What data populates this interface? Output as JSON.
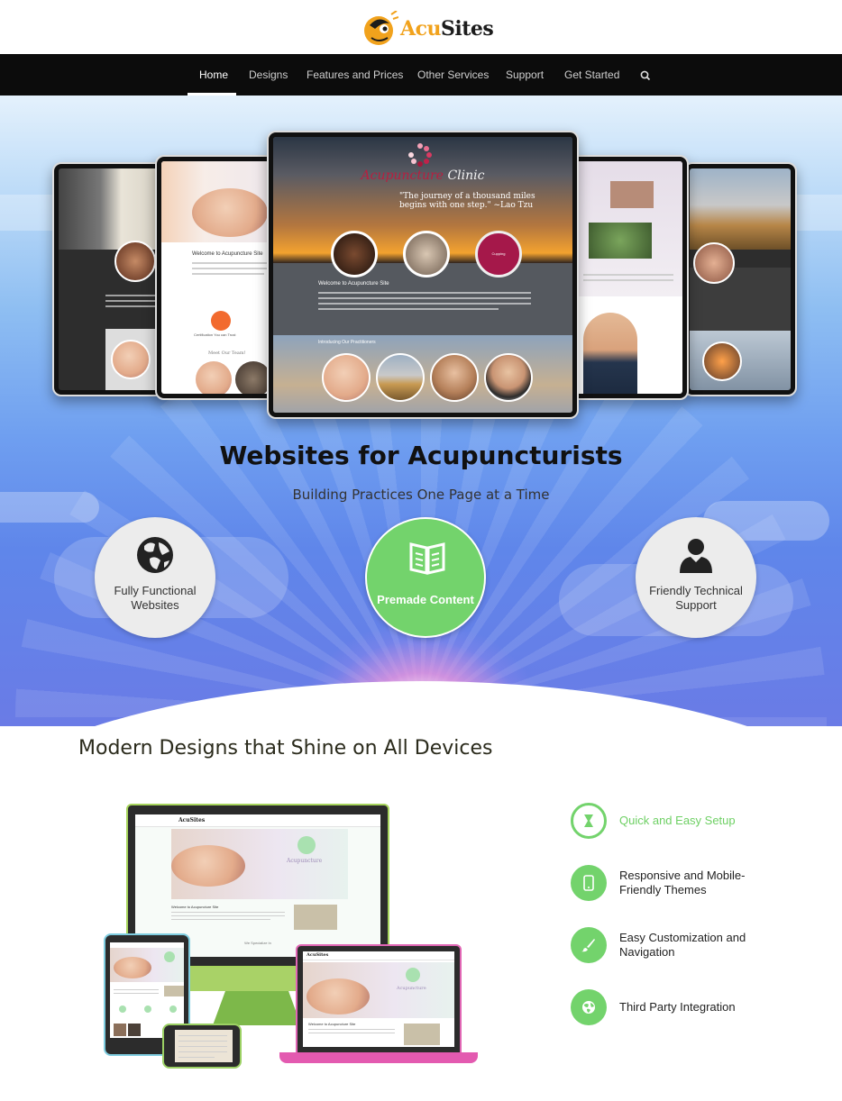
{
  "header": {
    "logo_text_acu": "Acu",
    "logo_text_sites": "Sites"
  },
  "nav": {
    "items": [
      {
        "label": "Home",
        "active": true
      },
      {
        "label": "Designs"
      },
      {
        "label": "Features and Prices"
      },
      {
        "label": "Other Services"
      },
      {
        "label": "Support"
      },
      {
        "label": "Get Started"
      }
    ],
    "search_icon": "search-icon"
  },
  "hero": {
    "title": "Websites for Acupuncturists",
    "subtitle": "Building Practices One Page at a Time",
    "showcase": {
      "clinic_name_1": "Acupuncture",
      "clinic_name_2": "Clinic",
      "quote": "\"The journey of a thousand miles begins with one step.\" ~Lao Tzu",
      "welcome": "Welcome to Acupuncture Site",
      "practitioners_label": "Introducing Our Practitioners",
      "cupping": "Cupping",
      "left_welcome": "Welcome to Acupuncture Site",
      "left_cert": "Certification You can Trust",
      "left_team": "Meet Our Team!"
    },
    "features": [
      {
        "label": "Fully Functional Websites",
        "icon": "globe-icon"
      },
      {
        "label": "Premade Content",
        "icon": "book-icon",
        "highlight": true
      },
      {
        "label": "Friendly Technical Support",
        "icon": "person-icon"
      }
    ]
  },
  "devices_section": {
    "title": "Modern Designs that Shine on All Devices",
    "mockup_text": {
      "brand": "AcuSites",
      "acupuncture": "Acupuncture",
      "welcome": "Welcome to Acupuncture Site",
      "specialize": "We Specialize In"
    },
    "benefits": [
      {
        "label": "Quick and Easy Setup",
        "icon": "hourglass-icon",
        "active": true
      },
      {
        "label": "Responsive and Mobile-Friendly Themes",
        "icon": "mobile-icon"
      },
      {
        "label": "Easy Customization and Navigation",
        "icon": "brush-icon"
      },
      {
        "label": "Third Party Integration",
        "icon": "globe-icon"
      }
    ]
  },
  "colors": {
    "accent_green": "#73d36c",
    "nav_bg": "#0c0c0c",
    "logo_orange": "#f1a21c"
  }
}
